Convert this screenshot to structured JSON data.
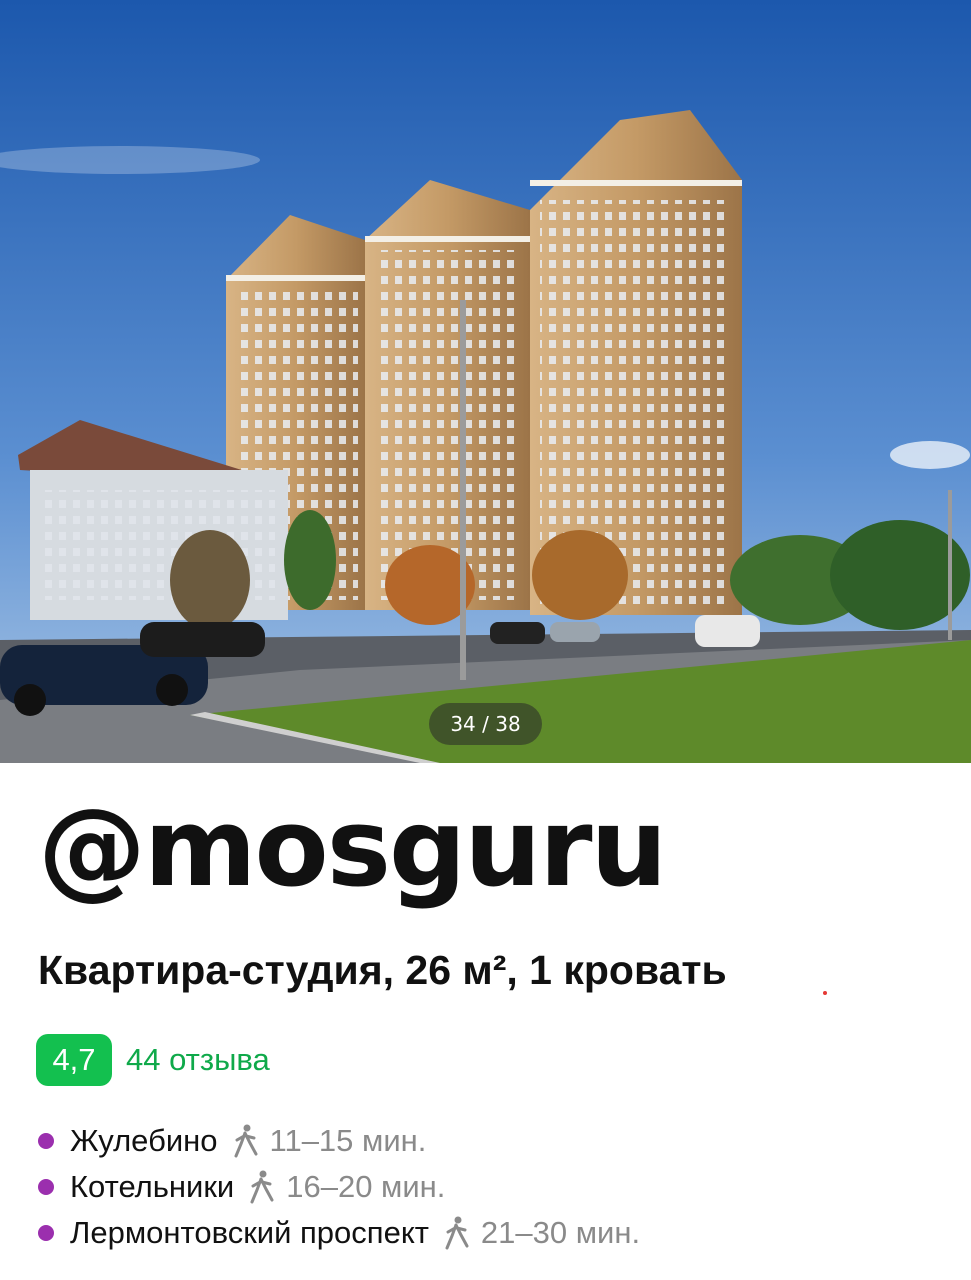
{
  "gallery": {
    "counter": "34 / 38",
    "colors": {
      "sky_top": "#1f5fb4",
      "sky_bottom": "#8fb7e3",
      "grass": "#5e8a2a",
      "facade": "#c49a66"
    }
  },
  "watermark": {
    "text": "@mosguru"
  },
  "listing": {
    "title": "Квартира-студия, 26 м², 1 кровать"
  },
  "rating": {
    "score": "4,7",
    "reviews": "44 отзыва",
    "badge_color": "#13c04f"
  },
  "metro": [
    {
      "name": "Жулебино",
      "time": "11–15 мин.",
      "icon": "walk-icon",
      "line_color": "#9b2fae"
    },
    {
      "name": "Котельники",
      "time": "16–20 мин.",
      "icon": "walk-icon",
      "line_color": "#9b2fae"
    },
    {
      "name": "Лермонтовский проспект",
      "time": "21–30 мин.",
      "icon": "walk-icon",
      "line_color": "#9b2fae"
    }
  ]
}
